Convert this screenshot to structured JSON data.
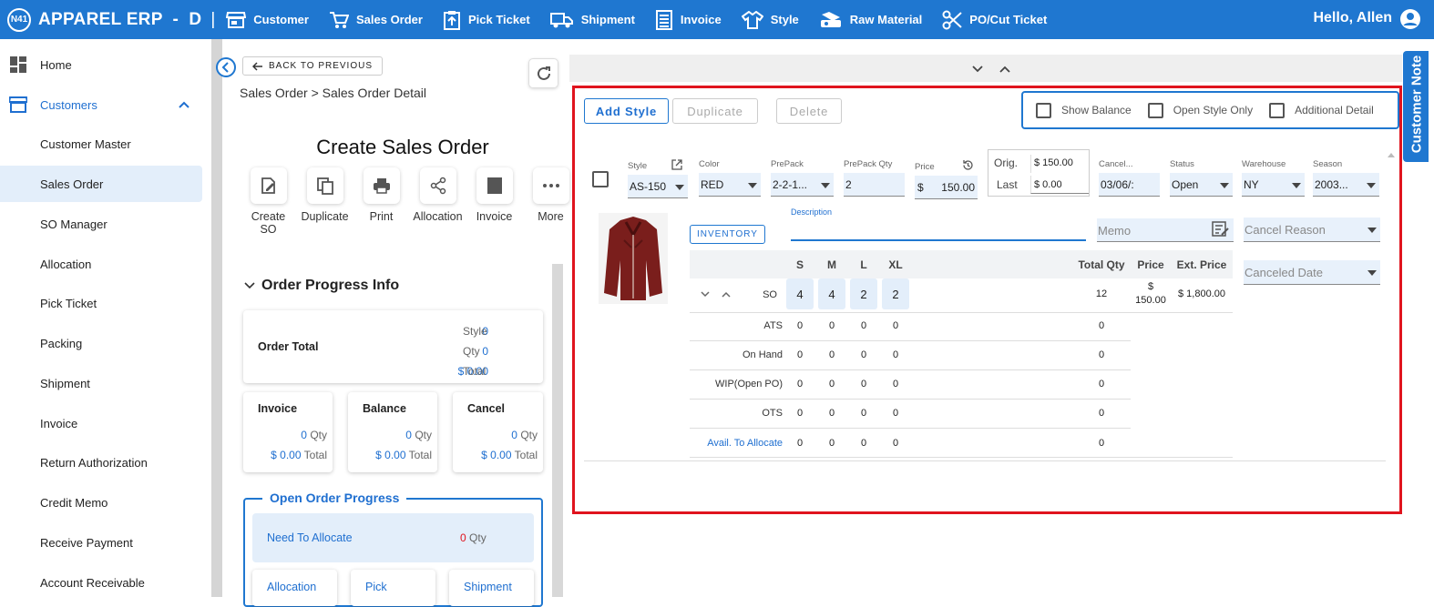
{
  "app": {
    "logo": "N41",
    "title": "APPAREL ERP",
    "dash": "-",
    "env": "D",
    "sep": "|",
    "greeting": "Hello, Allen"
  },
  "topnav": [
    {
      "label": "Customer",
      "icon": "store-icon"
    },
    {
      "label": "Sales Order",
      "icon": "cart-icon"
    },
    {
      "label": "Pick Ticket",
      "icon": "clipboard-upload-icon"
    },
    {
      "label": "Shipment",
      "icon": "truck-icon"
    },
    {
      "label": "Invoice",
      "icon": "receipt-icon"
    },
    {
      "label": "Style",
      "icon": "shirt-icon"
    },
    {
      "label": "Raw Material",
      "icon": "fabric-roll-icon"
    },
    {
      "label": "PO/Cut Ticket",
      "icon": "scissors-icon"
    }
  ],
  "sidebar": {
    "home": "Home",
    "customers": "Customers",
    "items": [
      "Customer Master",
      "Sales Order",
      "SO Manager",
      "Allocation",
      "Pick Ticket",
      "Packing",
      "Shipment",
      "Invoice",
      "Return Authorization",
      "Credit Memo",
      "Receive Payment",
      "Account Receivable"
    ]
  },
  "middle": {
    "back": "BACK TO PREVIOUS",
    "breadcrumb": "Sales Order > Sales Order Detail",
    "title": "Create Sales Order",
    "actions": [
      {
        "label": "Create\nSO",
        "icon": "create-so-icon"
      },
      {
        "label": "Duplicate",
        "icon": "duplicate-icon"
      },
      {
        "label": "Print",
        "icon": "print-icon"
      },
      {
        "label": "Allocation",
        "icon": "share-icon"
      },
      {
        "label": "Invoice",
        "icon": "invoice-icon"
      },
      {
        "label": "More",
        "icon": "more-icon"
      }
    ],
    "progress_title": "Order Progress Info",
    "order_total": {
      "label": "Order Total",
      "style_num": "0",
      "style_lbl": "Style",
      "qty_num": "0",
      "qty_lbl": "Qty",
      "total_num": "$ 0.00",
      "total_lbl": "Total"
    },
    "mini": [
      {
        "label": "Invoice",
        "qty": "0",
        "qty_lbl": "Qty",
        "total": "$ 0.00",
        "total_lbl": "Total"
      },
      {
        "label": "Balance",
        "qty": "0",
        "qty_lbl": "Qty",
        "total": "$ 0.00",
        "total_lbl": "Total"
      },
      {
        "label": "Cancel",
        "qty": "0",
        "qty_lbl": "Qty",
        "total": "$ 0.00",
        "total_lbl": "Total"
      }
    ],
    "open_progress": {
      "title": "Open Order Progress",
      "need_label": "Need To Allocate",
      "need_num": "0",
      "need_lbl": "Qty",
      "tabs": [
        "Allocation",
        "Pick",
        "Shipment"
      ]
    }
  },
  "detail": {
    "buttons": {
      "add": "Add Style",
      "duplicate": "Duplicate",
      "delete": "Delete"
    },
    "checks": [
      "Show Balance",
      "Open Style Only",
      "Additional Detail"
    ],
    "fields": {
      "style": {
        "label": "Style",
        "value": "AS-150"
      },
      "color": {
        "label": "Color",
        "value": "RED"
      },
      "prepack": {
        "label": "PrePack",
        "value": "2-2-1..."
      },
      "prepack_qty": {
        "label": "PrePack Qty",
        "value": "2"
      },
      "price": {
        "label": "Price",
        "currency": "$",
        "value": "150.00"
      },
      "orig": {
        "label": "Orig.",
        "value": "$ 150.00"
      },
      "last": {
        "label": "Last",
        "value": "$ 0.00"
      },
      "cancel": {
        "label": "Cancel...",
        "value": "03/06/:"
      },
      "status": {
        "label": "Status",
        "value": "Open"
      },
      "warehouse": {
        "label": "Warehouse",
        "value": "NY"
      },
      "season": {
        "label": "Season",
        "value": "2003..."
      }
    },
    "inventory_btn": "INVENTORY",
    "description_label": "Description",
    "memo_placeholder": "Memo",
    "cancel_reason": "Cancel Reason",
    "canceled_date": "Canceled Date",
    "grid": {
      "sizes": [
        "S",
        "M",
        "L",
        "XL"
      ],
      "total_qty_hdr": "Total Qty",
      "price_hdr": "Price",
      "ext_price_hdr": "Ext. Price",
      "so": {
        "label": "SO",
        "values": [
          "4",
          "4",
          "2",
          "2"
        ],
        "total": "12",
        "price_cur": "$",
        "price": "150.00",
        "ext": "$ 1,800.00"
      },
      "rows": [
        {
          "label": "ATS",
          "values": [
            "0",
            "0",
            "0",
            "0"
          ],
          "total": "0"
        },
        {
          "label": "On Hand",
          "values": [
            "0",
            "0",
            "0",
            "0"
          ],
          "total": "0"
        },
        {
          "label": "WIP(Open PO)",
          "values": [
            "0",
            "0",
            "0",
            "0"
          ],
          "total": "0"
        },
        {
          "label": "OTS",
          "values": [
            "0",
            "0",
            "0",
            "0"
          ],
          "total": "0"
        },
        {
          "label": "Avail. To Allocate",
          "values": [
            "0",
            "0",
            "0",
            "0"
          ],
          "total": "0"
        }
      ]
    }
  },
  "side_tab": "Customer Note",
  "colors": {
    "primary": "#1f77d0",
    "highlight": "#e0141e",
    "selected": "#e3eefa"
  }
}
